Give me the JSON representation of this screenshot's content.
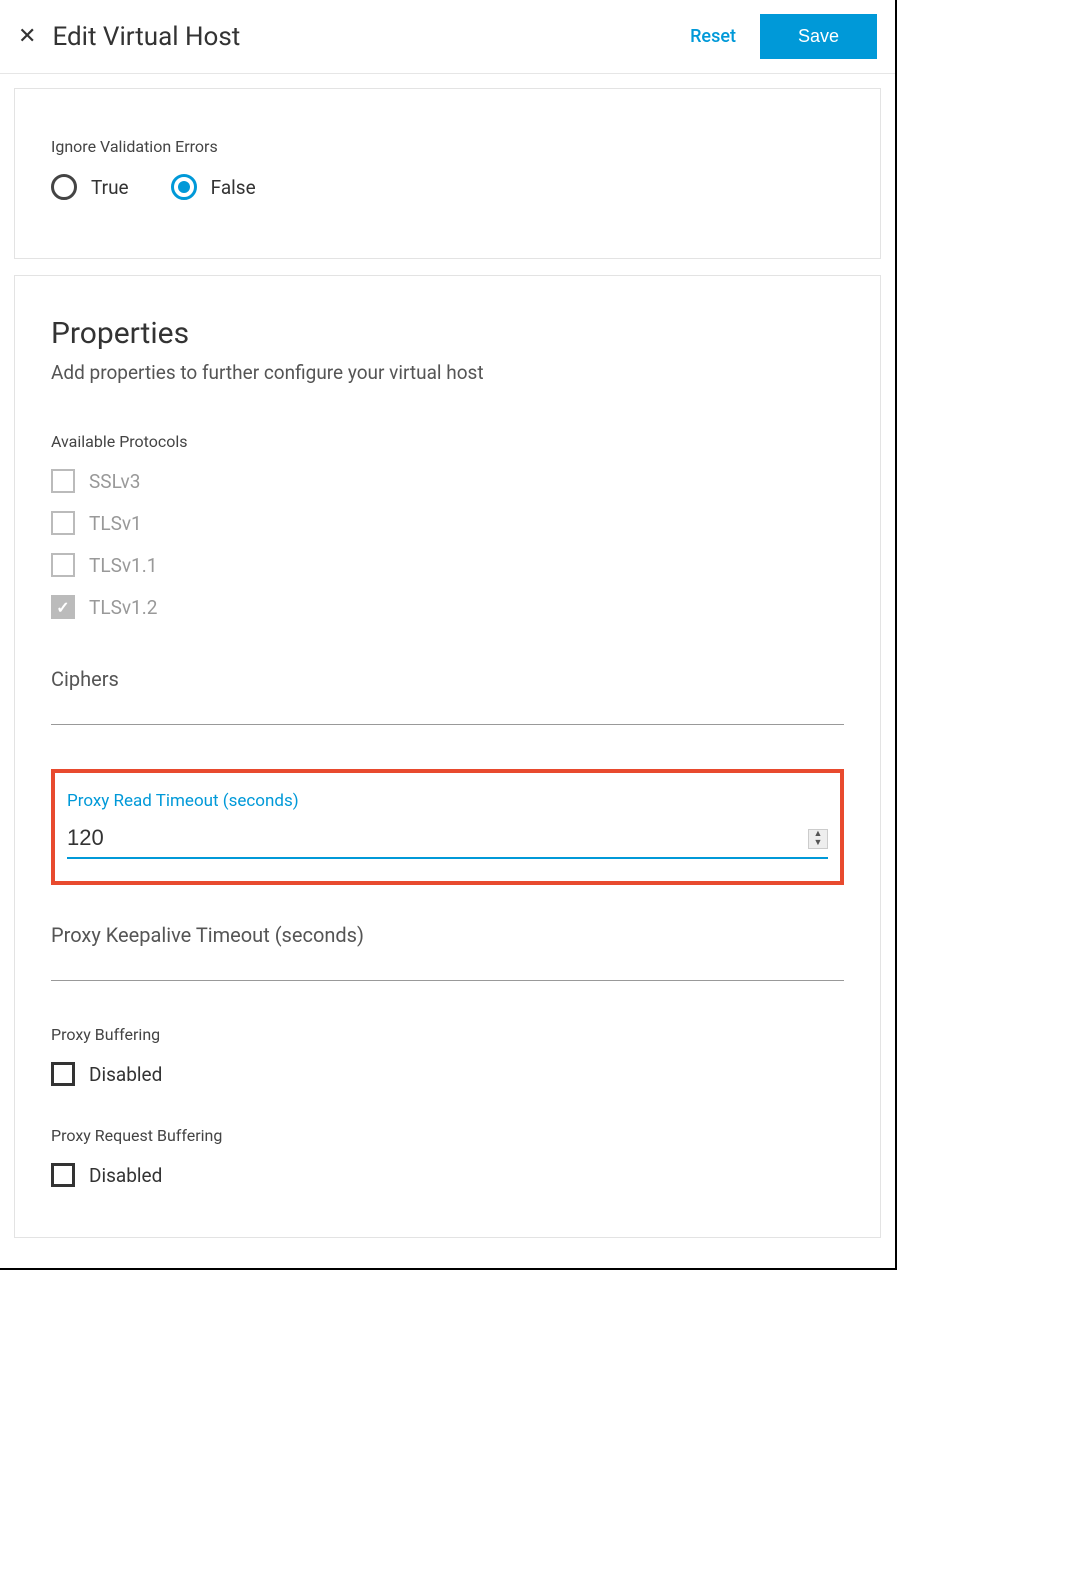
{
  "header": {
    "title": "Edit Virtual Host",
    "reset": "Reset",
    "save": "Save"
  },
  "validation": {
    "label": "Ignore Validation Errors",
    "true_label": "True",
    "false_label": "False",
    "value": "False"
  },
  "properties": {
    "title": "Properties",
    "subtitle": "Add properties to further configure your virtual host",
    "protocols_label": "Available Protocols",
    "protocols": [
      {
        "label": "SSLv3",
        "checked": false
      },
      {
        "label": "TLSv1",
        "checked": false
      },
      {
        "label": "TLSv1.1",
        "checked": false
      },
      {
        "label": "TLSv1.2",
        "checked": true
      }
    ],
    "ciphers_label": "Ciphers",
    "ciphers_value": "",
    "proxy_read_timeout_label": "Proxy Read Timeout (seconds)",
    "proxy_read_timeout_value": "120",
    "proxy_keepalive_label": "Proxy Keepalive Timeout (seconds)",
    "proxy_keepalive_value": "",
    "proxy_buffering_label": "Proxy Buffering",
    "proxy_buffering_option": "Disabled",
    "proxy_request_buffering_label": "Proxy Request Buffering",
    "proxy_request_buffering_option": "Disabled"
  }
}
